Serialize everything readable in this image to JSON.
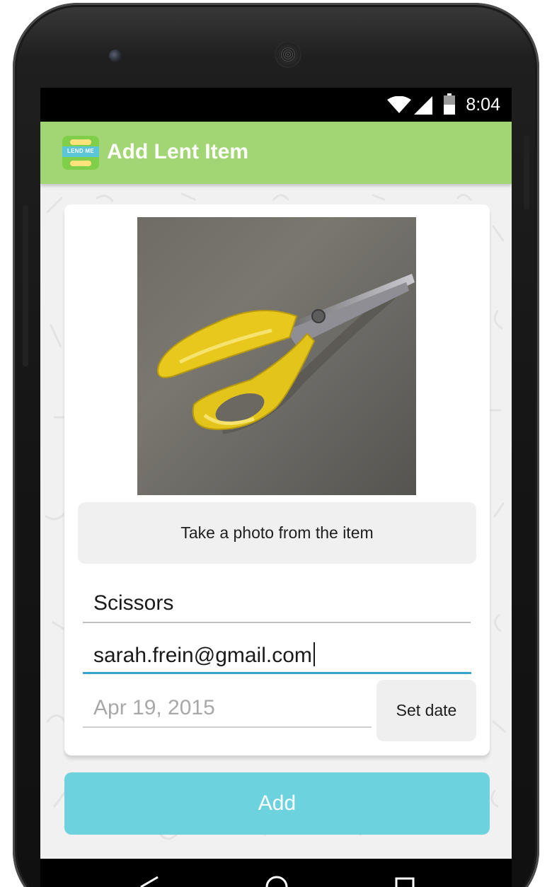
{
  "status_bar": {
    "time": "8:04",
    "icons": [
      "wifi-icon",
      "signal-icon",
      "battery-icon"
    ]
  },
  "app_bar": {
    "logo_text": "LEND ME",
    "title": "Add Lent Item",
    "color": "#a2d574"
  },
  "form": {
    "photo_button_label": "Take a photo from the item",
    "name_value": "Scissors",
    "email_value": "sarah.frein@gmail.com",
    "date_value": "Apr 19, 2015",
    "set_date_label": "Set date",
    "focused_field_color": "#3aa3c9"
  },
  "add_button": {
    "label": "Add",
    "color": "#6cd2de"
  },
  "nav_bar": {
    "icons": [
      "back-icon",
      "home-icon",
      "recents-icon"
    ]
  }
}
